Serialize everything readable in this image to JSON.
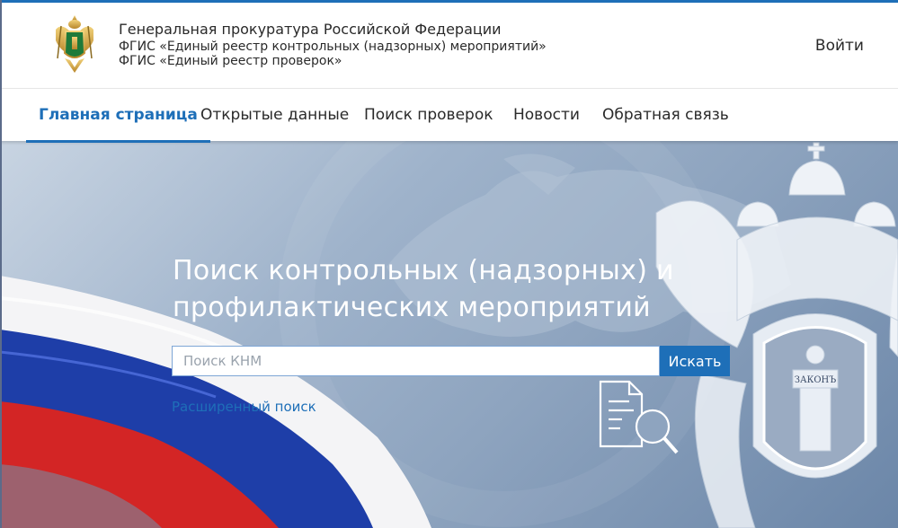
{
  "header": {
    "org_title": "Генеральная прокуратура Российской Федерации",
    "subtitle_1": "ФГИС «Единый реестр контрольных (надзорных) мероприятий»",
    "subtitle_2": "ФГИС «Единый реестр проверок»",
    "login_label": "Войти"
  },
  "nav": {
    "items": [
      {
        "label": "Главная страница",
        "active": true
      },
      {
        "label": "Открытые данные",
        "active": false
      },
      {
        "label": "Поиск проверок",
        "active": false
      },
      {
        "label": "Новости",
        "active": false
      },
      {
        "label": "Обратная связь",
        "active": false
      }
    ]
  },
  "hero": {
    "title_line_1": "Поиск контрольных (надзорных) и",
    "title_line_2": "профилактических мероприятий",
    "search_placeholder": "Поиск КНМ",
    "search_value": "",
    "search_button": "Искать",
    "advanced_search": "Расширенный поиск",
    "emblem_text": "ЗАКОНЪ"
  },
  "icons": [
    "emblem-icon",
    "document-search-icon",
    "flag-graphic",
    "prosecutor-emblem-graphic"
  ],
  "colors": {
    "accent": "#1e6fb8",
    "hero_bg": "#8ea4bf",
    "text": "#2a2a2a"
  }
}
